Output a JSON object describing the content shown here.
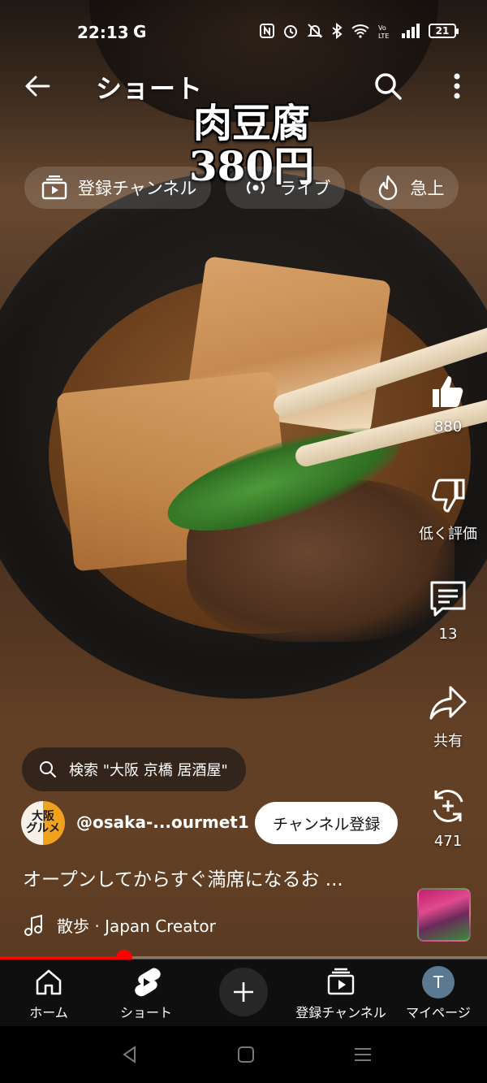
{
  "status_bar": {
    "time": "22:13",
    "google_icon": "G",
    "battery_level": "21",
    "icons": [
      "nfc-icon",
      "alarm-icon",
      "mute-icon",
      "bluetooth-icon",
      "wifi-icon",
      "volte-icon",
      "signal-icon",
      "battery-icon"
    ]
  },
  "header": {
    "title": "ショート",
    "back_icon": "arrow-left-icon",
    "search_icon": "search-icon",
    "more_icon": "more-vert-icon"
  },
  "video_caption": {
    "line1": "肉豆腐",
    "line2": "380円"
  },
  "chips": [
    {
      "icon": "subscriptions-icon",
      "label": "登録チャンネル"
    },
    {
      "icon": "live-icon",
      "label": "ライブ"
    },
    {
      "icon": "trending-icon",
      "label": "急上"
    }
  ],
  "actions": {
    "like": {
      "icon": "thumb-up-icon",
      "label": "880"
    },
    "dislike": {
      "icon": "thumb-down-icon",
      "label": "低く評価"
    },
    "comments": {
      "icon": "comment-icon",
      "label": "13"
    },
    "share": {
      "icon": "share-icon",
      "label": "共有"
    },
    "remix": {
      "icon": "remix-icon",
      "label": "471"
    }
  },
  "search_suggestion": "検索 \"大阪 京橋 居酒屋\"",
  "channel": {
    "avatar_text": "大阪\nグルメ",
    "handle": "@osaka-...ourmet1",
    "subscribe_label": "チャンネル登録"
  },
  "description": "オープンしてからすぐ満席になるお ...",
  "music": {
    "icon": "music-note-icon",
    "text": "散歩 · Japan Creator"
  },
  "progress": {
    "fraction": 0.255
  },
  "bottom_nav": {
    "home": "ホーム",
    "shorts": "ショート",
    "create_icon": "plus-icon",
    "subscriptions": "登録チャンネル",
    "you": "マイページ",
    "you_avatar": "T"
  },
  "colors": {
    "accent_red": "#ff0000",
    "nav_bg": "#0f0f0f",
    "subscribe_bg": "#ffffff"
  }
}
